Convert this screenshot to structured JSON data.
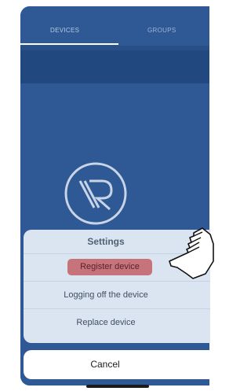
{
  "tabs": {
    "devices": "DEVICES",
    "groups": "GROUPS"
  },
  "sheet": {
    "title": "Settings",
    "items": [
      "Register device",
      "Logging off the device",
      "Replace device"
    ],
    "cancel": "Cancel"
  },
  "icons": {
    "logo": "brand-logo",
    "cursor": "hand-pointer-icon"
  },
  "colors": {
    "header": "#2f5994",
    "highlight": "#c7737c",
    "sheet": "#dbe5f2"
  }
}
